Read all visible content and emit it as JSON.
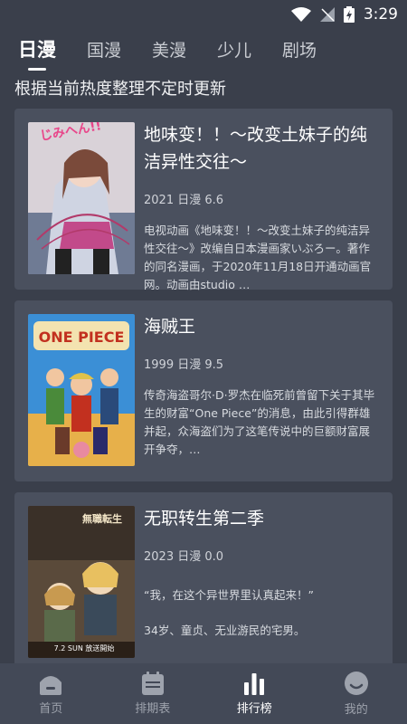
{
  "status": {
    "time": "3:29"
  },
  "tabs": [
    {
      "label": "日漫",
      "active": true
    },
    {
      "label": "国漫",
      "active": false
    },
    {
      "label": "美漫",
      "active": false
    },
    {
      "label": "少儿",
      "active": false
    },
    {
      "label": "剧场",
      "active": false
    }
  ],
  "subtitle": "根据当前热度整理不定时更新",
  "cards": [
    {
      "title": "地味变！！～改变土妹子的纯洁异性交往～",
      "meta": "2021  日漫  6.6",
      "desc": "电视动画《地味变！！～改变土妹子的纯洁异性交往～》改编自日本漫画家いぶろー。著作的同名漫画，于2020年11月18日开通动画官网。动画由studio …"
    },
    {
      "title": "海贼王",
      "meta": "1999  日漫  9.5",
      "desc": "传奇海盗哥尔·D·罗杰在临死前曾留下关于其毕生的财富“One Piece”的消息，由此引得群雄并起，众海盗们为了这笔传说中的巨额财富展开争夺，…"
    },
    {
      "title": "无职转生第二季",
      "meta": "2023  日漫  0.0",
      "quote": "“我，在这个异世界里认真起来！”",
      "desc": "34岁、童贞、无业游民的宅男。"
    }
  ],
  "nav": [
    {
      "label": "首页",
      "icon": "home-icon",
      "active": false
    },
    {
      "label": "排期表",
      "icon": "calendar-icon",
      "active": false
    },
    {
      "label": "排行榜",
      "icon": "bar-chart-icon",
      "active": true
    },
    {
      "label": "我的",
      "icon": "profile-icon",
      "active": false
    }
  ],
  "poster_texts": {
    "poster1_logo": "じみへん!!",
    "poster2_logo": "ONE PIECE",
    "poster3_logo": "無職転生",
    "poster3_date": "7.2 SUN 放送開始"
  }
}
